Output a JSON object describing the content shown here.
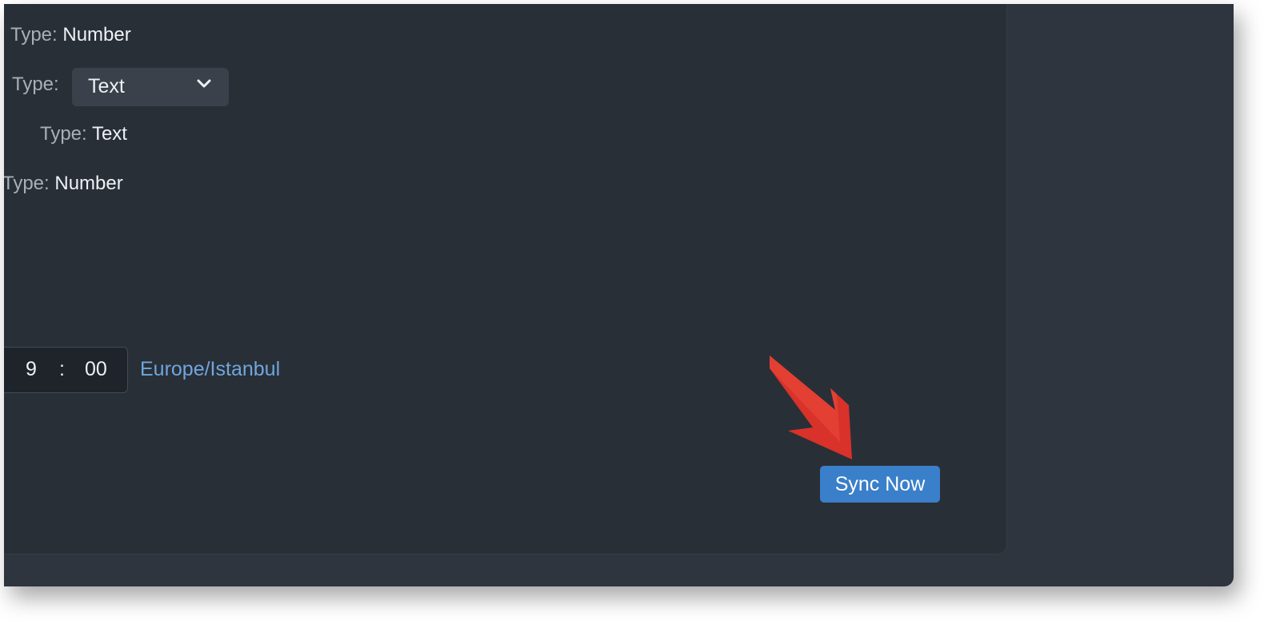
{
  "fields": [
    {
      "label": "Type:",
      "value": "Number"
    },
    {
      "label": "Type:",
      "value": "Text",
      "control": "dropdown"
    },
    {
      "label": "Type:",
      "value": "Text"
    },
    {
      "label": "Type:",
      "value": "Number"
    }
  ],
  "schedule": {
    "hour": "9",
    "separator": ":",
    "minute": "00",
    "timezone": "Europe/Istanbul"
  },
  "actions": {
    "sync_label": "Sync Now"
  },
  "colors": {
    "panel_bg": "#292f37",
    "window_bg": "#2f353e",
    "link": "#6fa6dc",
    "primary_button": "#3a7fc9",
    "annotation_arrow": "#d8322a"
  },
  "icons": {
    "dropdown": "chevron-down-icon",
    "annotation": "red-arrow-pointer"
  }
}
